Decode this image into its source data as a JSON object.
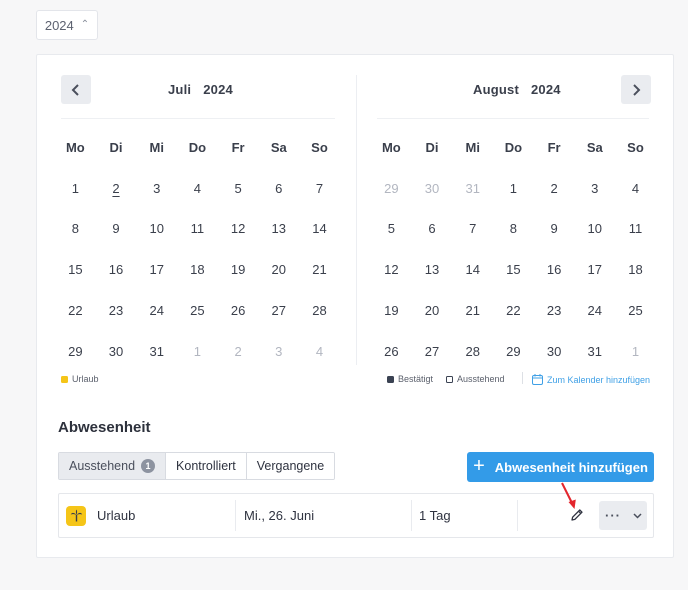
{
  "year_select": {
    "value": "2024"
  },
  "calendar": {
    "weekdays": [
      "Mo",
      "Di",
      "Mi",
      "Do",
      "Fr",
      "Sa",
      "So"
    ],
    "left": {
      "month": "Juli",
      "year": "2024",
      "weeks": [
        [
          "1",
          "2",
          "3",
          "4",
          "5",
          "6",
          "7"
        ],
        [
          "8",
          "9",
          "10",
          "11",
          "12",
          "13",
          "14"
        ],
        [
          "15",
          "16",
          "17",
          "18",
          "19",
          "20",
          "21"
        ],
        [
          "22",
          "23",
          "24",
          "25",
          "26",
          "27",
          "28"
        ],
        [
          "29",
          "30",
          "31",
          "1",
          "2",
          "3",
          "4"
        ]
      ]
    },
    "right": {
      "month": "August",
      "year": "2024",
      "weeks": [
        [
          "29",
          "30",
          "31",
          "1",
          "2",
          "3",
          "4"
        ],
        [
          "5",
          "6",
          "7",
          "8",
          "9",
          "10",
          "11"
        ],
        [
          "12",
          "13",
          "14",
          "15",
          "16",
          "17",
          "18"
        ],
        [
          "19",
          "20",
          "21",
          "22",
          "23",
          "24",
          "25"
        ],
        [
          "26",
          "27",
          "28",
          "29",
          "30",
          "31",
          "1"
        ]
      ]
    }
  },
  "legend": {
    "urlaub": "Urlaub",
    "bestaetigt": "Bestätigt",
    "ausstehend": "Ausstehend",
    "add_calendar": "Zum Kalender hinzufügen"
  },
  "absence": {
    "title": "Abwesenheit",
    "tabs": {
      "pending": {
        "label": "Ausstehend",
        "count": "1"
      },
      "checked": {
        "label": "Kontrolliert"
      },
      "past": {
        "label": "Vergangene"
      }
    },
    "add_button": "Abwesenheit hinzufügen",
    "rows": [
      {
        "type": "Urlaub",
        "date": "Mi., 26. Juni",
        "duration": "1 Tag"
      }
    ],
    "more_label": "···"
  },
  "colors": {
    "accent": "#339be8",
    "vacation": "#f5c518",
    "confirmed": "#3a4252",
    "annotation_arrow": "#e3262d"
  },
  "icons": {
    "prev": "chevron-left-icon",
    "next": "chevron-right-icon",
    "calendar": "calendar-icon",
    "plus": "plus-icon",
    "vacation": "palm-tree-icon",
    "edit": "pencil-icon",
    "more": "ellipsis-icon",
    "dropdown": "chevron-down-icon"
  }
}
